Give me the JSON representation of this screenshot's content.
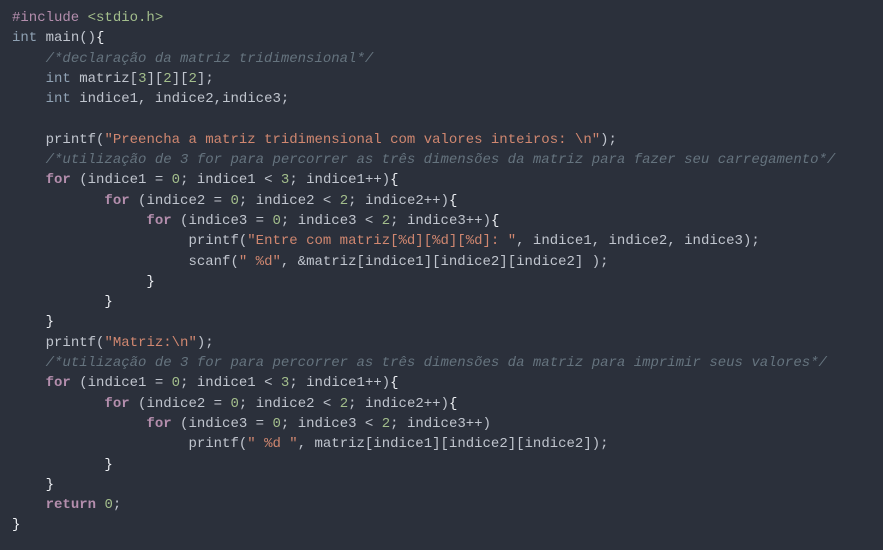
{
  "code": {
    "line1": {
      "include": "#include",
      "path": "<stdio.h>"
    },
    "line2": {
      "type": "int",
      "name": "main"
    },
    "line3": {
      "comment": "/*declaração da matriz tridimensional*/"
    },
    "line4": {
      "type": "int",
      "var": "matriz",
      "dim1": "3",
      "dim2": "2",
      "dim3": "2"
    },
    "line5": {
      "type": "int",
      "var1": "indice1",
      "var2": "indice2",
      "var3": "indice3"
    },
    "line7": {
      "func": "printf",
      "str": "\"Preencha a matriz tridimensional com valores inteiros: \\n\""
    },
    "line8": {
      "comment": "/*utilização de 3 for para percorrer as três dimensões da matriz para fazer seu carregamento*/"
    },
    "line9": {
      "kw": "for",
      "var": "indice1",
      "init": "0",
      "cond": "3"
    },
    "line10": {
      "kw": "for",
      "var": "indice2",
      "init": "0",
      "cond": "2"
    },
    "line11": {
      "kw": "for",
      "var": "indice3",
      "init": "0",
      "cond": "2"
    },
    "line12": {
      "func": "printf",
      "str": "\"Entre com matriz[%d][%d][%d]: \"",
      "args": ", indice1, indice2, indice3"
    },
    "line13": {
      "func": "scanf",
      "str": "\" %d\"",
      "args": ", &matriz[indice1][indice2][indice2] "
    },
    "line17": {
      "func": "printf",
      "str": "\"Matriz:\\n\""
    },
    "line18": {
      "comment": "/*utilização de 3 for para percorrer as três dimensões da matriz para imprimir seus valores*/"
    },
    "line19": {
      "kw": "for",
      "var": "indice1",
      "init": "0",
      "cond": "3"
    },
    "line20": {
      "kw": "for",
      "var": "indice2",
      "init": "0",
      "cond": "2"
    },
    "line21": {
      "kw": "for",
      "var": "indice3",
      "init": "0",
      "cond": "2"
    },
    "line22": {
      "func": "printf",
      "str": "\" %d \"",
      "args": ", matriz[indice1][indice2][indice2]"
    },
    "line25": {
      "kw": "return",
      "val": "0"
    }
  }
}
